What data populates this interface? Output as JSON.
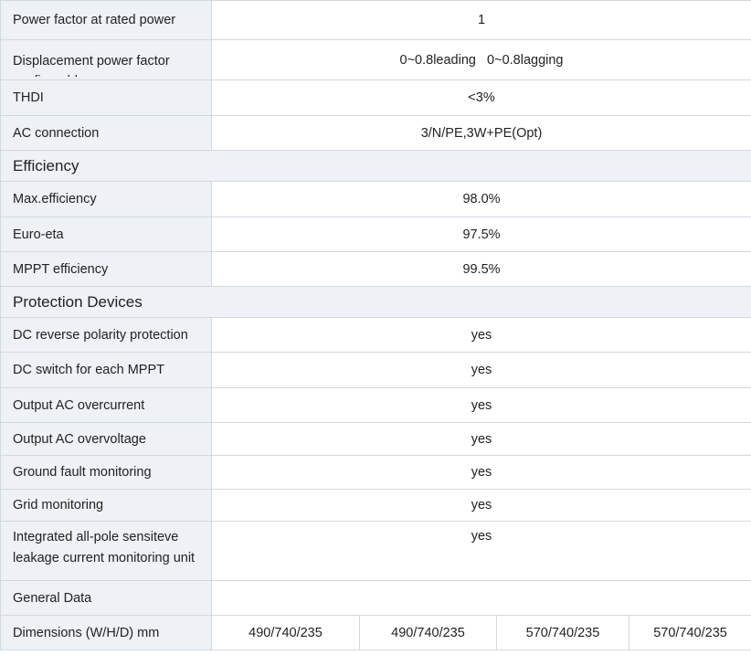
{
  "rows_a": [
    {
      "label": "Power factor at rated power",
      "value": "1"
    },
    {
      "label": "Displacement power factor configurable",
      "value": "0~0.8leading   0~0.8lagging"
    },
    {
      "label": "THDI",
      "value": "<3%"
    },
    {
      "label": "AC connection",
      "value": "3/N/PE,3W+PE(Opt)"
    }
  ],
  "section_efficiency": "Efficiency",
  "rows_b": [
    {
      "label": "Max.efficiency",
      "value": "98.0%"
    },
    {
      "label": "Euro-eta",
      "value": "97.5%"
    },
    {
      "label": "MPPT efficiency",
      "value": "99.5%"
    }
  ],
  "section_protection": "Protection Devices",
  "rows_c": [
    {
      "label": "DC reverse polarity protection",
      "value": "yes"
    },
    {
      "label": "DC switch for each MPPT",
      "value": "yes"
    },
    {
      "label": "Output AC overcurrent",
      "value": "yes"
    },
    {
      "label": "Output AC overvoltage",
      "value": "yes"
    },
    {
      "label": "Ground fault monitoring",
      "value": "yes"
    },
    {
      "label": "Grid monitoring",
      "value": "yes"
    },
    {
      "label": "Integrated all-pole sensiteve leakage current monitoring unit",
      "value": "yes"
    }
  ],
  "general_data": {
    "label": "General Data",
    "value": ""
  },
  "dimensions": {
    "label": "Dimensions (W/H/D) mm",
    "values": [
      "490/740/235",
      "490/740/235",
      "570/740/235",
      "570/740/235"
    ]
  }
}
